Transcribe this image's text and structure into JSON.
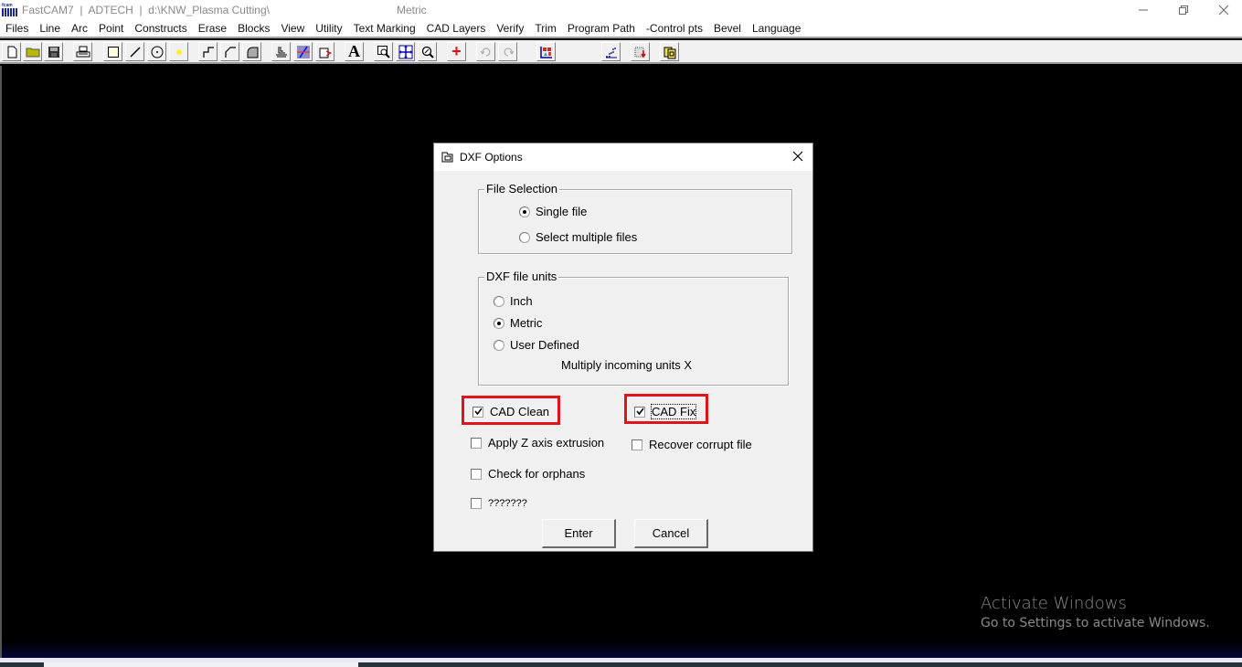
{
  "titlebar": {
    "title": "FastCAM7  |  ADTECH  |  d:\\KNW_Plasma Cutting\\",
    "units": "Metric",
    "app_icon_text": "fcam"
  },
  "menubar": {
    "items": [
      "Files",
      "Line",
      "Arc",
      "Point",
      "Constructs",
      "Erase",
      "Blocks",
      "View",
      "Utility",
      "Text Marking",
      "CAD Layers",
      "Verify",
      "Trim",
      "Program Path",
      "-Control pts",
      "Bevel",
      "Language"
    ]
  },
  "toolbar": {
    "buttons": [
      {
        "name": "new-file",
        "icon": "new-file-icon"
      },
      {
        "name": "open-file",
        "icon": "folder-icon"
      },
      {
        "name": "save-file",
        "icon": "save-icon"
      },
      {
        "name": "print",
        "icon": "printer-icon"
      },
      {
        "name": "rectangle",
        "icon": "rectangle-icon"
      },
      {
        "name": "line",
        "icon": "line-icon"
      },
      {
        "name": "circle",
        "icon": "circle-icon"
      },
      {
        "name": "point",
        "icon": "point-icon"
      },
      {
        "name": "step-path",
        "icon": "step-icon"
      },
      {
        "name": "chamfer",
        "icon": "chamfer-icon"
      },
      {
        "name": "fillet",
        "icon": "fillet-icon"
      },
      {
        "name": "machine",
        "icon": "torch-icon"
      },
      {
        "name": "trim",
        "icon": "trim-icon"
      },
      {
        "name": "export",
        "icon": "export-icon"
      },
      {
        "name": "text",
        "icon": "text-icon",
        "label": "A"
      },
      {
        "name": "zoom-window",
        "icon": "zoom-window-icon"
      },
      {
        "name": "zoom-extents",
        "icon": "zoom-extents-icon"
      },
      {
        "name": "zoom-in",
        "icon": "zoom-icon"
      },
      {
        "name": "add",
        "icon": "plus-icon",
        "label": "+"
      },
      {
        "name": "undo",
        "icon": "undo-icon"
      },
      {
        "name": "redo",
        "icon": "redo-icon"
      },
      {
        "name": "cad-layers",
        "icon": "layers-icon"
      },
      {
        "name": "program-path",
        "icon": "path-icon"
      },
      {
        "name": "verify",
        "icon": "verify-icon"
      },
      {
        "name": "nest",
        "icon": "nest-icon"
      }
    ]
  },
  "dialog": {
    "title": "DXF Options",
    "file_selection": {
      "label": "File Selection",
      "options": [
        {
          "label": "Single file",
          "checked": true
        },
        {
          "label": "Select multiple files",
          "checked": false
        }
      ]
    },
    "units": {
      "label": "DXF file units",
      "options": [
        {
          "label": "Inch",
          "checked": false
        },
        {
          "label": "Metric",
          "checked": true
        },
        {
          "label": "User Defined",
          "checked": false
        }
      ],
      "multiply_label": "Multiply incoming units X"
    },
    "checkboxes": {
      "cad_clean": {
        "label": "CAD Clean",
        "checked": true
      },
      "cad_fix": {
        "label": "CAD Fix",
        "checked": true
      },
      "apply_z": {
        "label": "Apply Z axis extrusion",
        "checked": false
      },
      "recover": {
        "label": "Recover corrupt file",
        "checked": false
      },
      "orphans": {
        "label": "Check for orphans",
        "checked": false
      },
      "unknown": {
        "label": "???????",
        "checked": false
      }
    },
    "enter_label": "Enter",
    "cancel_label": "Cancel",
    "highlight_color": "#e0141a"
  },
  "watermark": {
    "title": "Activate Windows",
    "subtitle": "Go to Settings to activate Windows."
  }
}
